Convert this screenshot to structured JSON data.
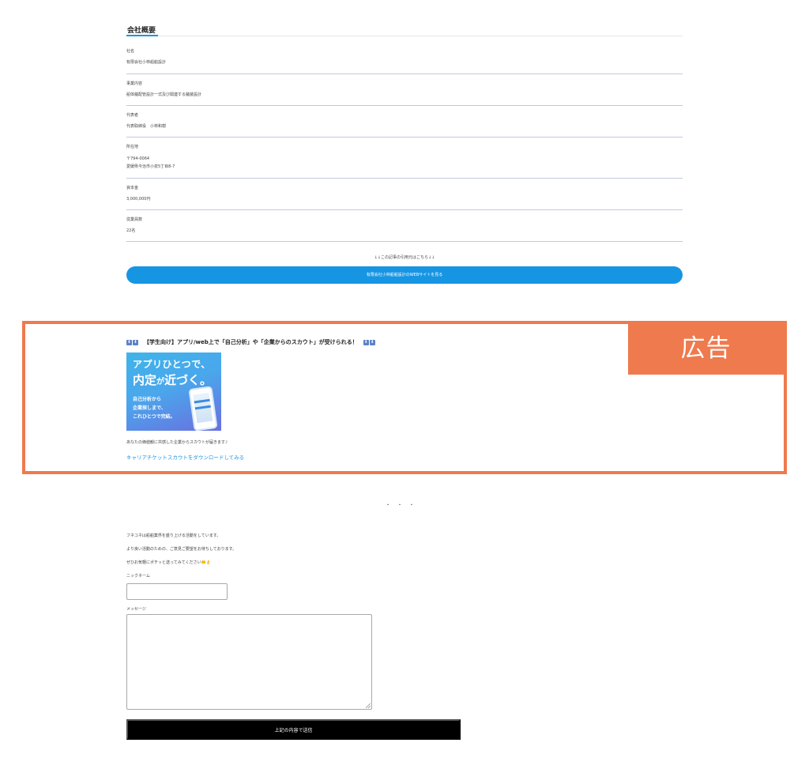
{
  "overview": {
    "title": "会社概要",
    "rows": [
      {
        "label": "社名",
        "lines": [
          "有限会社小林船舶設計"
        ]
      },
      {
        "label": "事業内容",
        "lines": [
          "船体艤配管設計一式及び関連する艤装設計"
        ]
      },
      {
        "label": "代表者",
        "lines": [
          "代表取締役　小林和樹"
        ]
      },
      {
        "label": "所在地",
        "lines": [
          "〒794-0064",
          "愛媛県今治市小泉5丁目8-7"
        ]
      },
      {
        "label": "資本金",
        "lines": [
          "3,000,000円"
        ]
      },
      {
        "label": "従業員数",
        "lines": [
          "22名"
        ]
      }
    ],
    "source_note": "↓↓この記事の引用元はこちら↓↓",
    "site_button": "有限会社小林船舶設計のWEBサイトを見る"
  },
  "ad": {
    "tag": "広告",
    "title": "【学生向け】アプリ/web上で「自己分析」や「企業からのスカウト」が受けられる！",
    "banner": {
      "line1": "アプリひとつで、",
      "line2_big1": "内定",
      "line2_small": "が",
      "line2_big2": "近づく。",
      "sub1": "自己分析から",
      "sub2": "企業探しまで、",
      "sub3": "これひとつで完結。"
    },
    "description": "あなたの価値観に共感した企業からスカウトが届きます♪",
    "link": "キャリアチケットスカウトをダウンロードしてみる"
  },
  "dots": "・・・",
  "form": {
    "intro1": "フネコネは船舶業界を盛り上げる活動をしています。",
    "intro2": "より良い活動のための、ご意見ご要望をお待ちしております。",
    "intro3": "ぜひお気軽にポチッと送ってみてください🤲👌",
    "nickname_label": "ニックネーム",
    "message_label": "メッセージ",
    "submit": "上記の内容で送信"
  },
  "colors": {
    "accent_blue": "#1695e3",
    "ad_orange": "#ef7a4e",
    "row_divider": "#c3c8df"
  }
}
